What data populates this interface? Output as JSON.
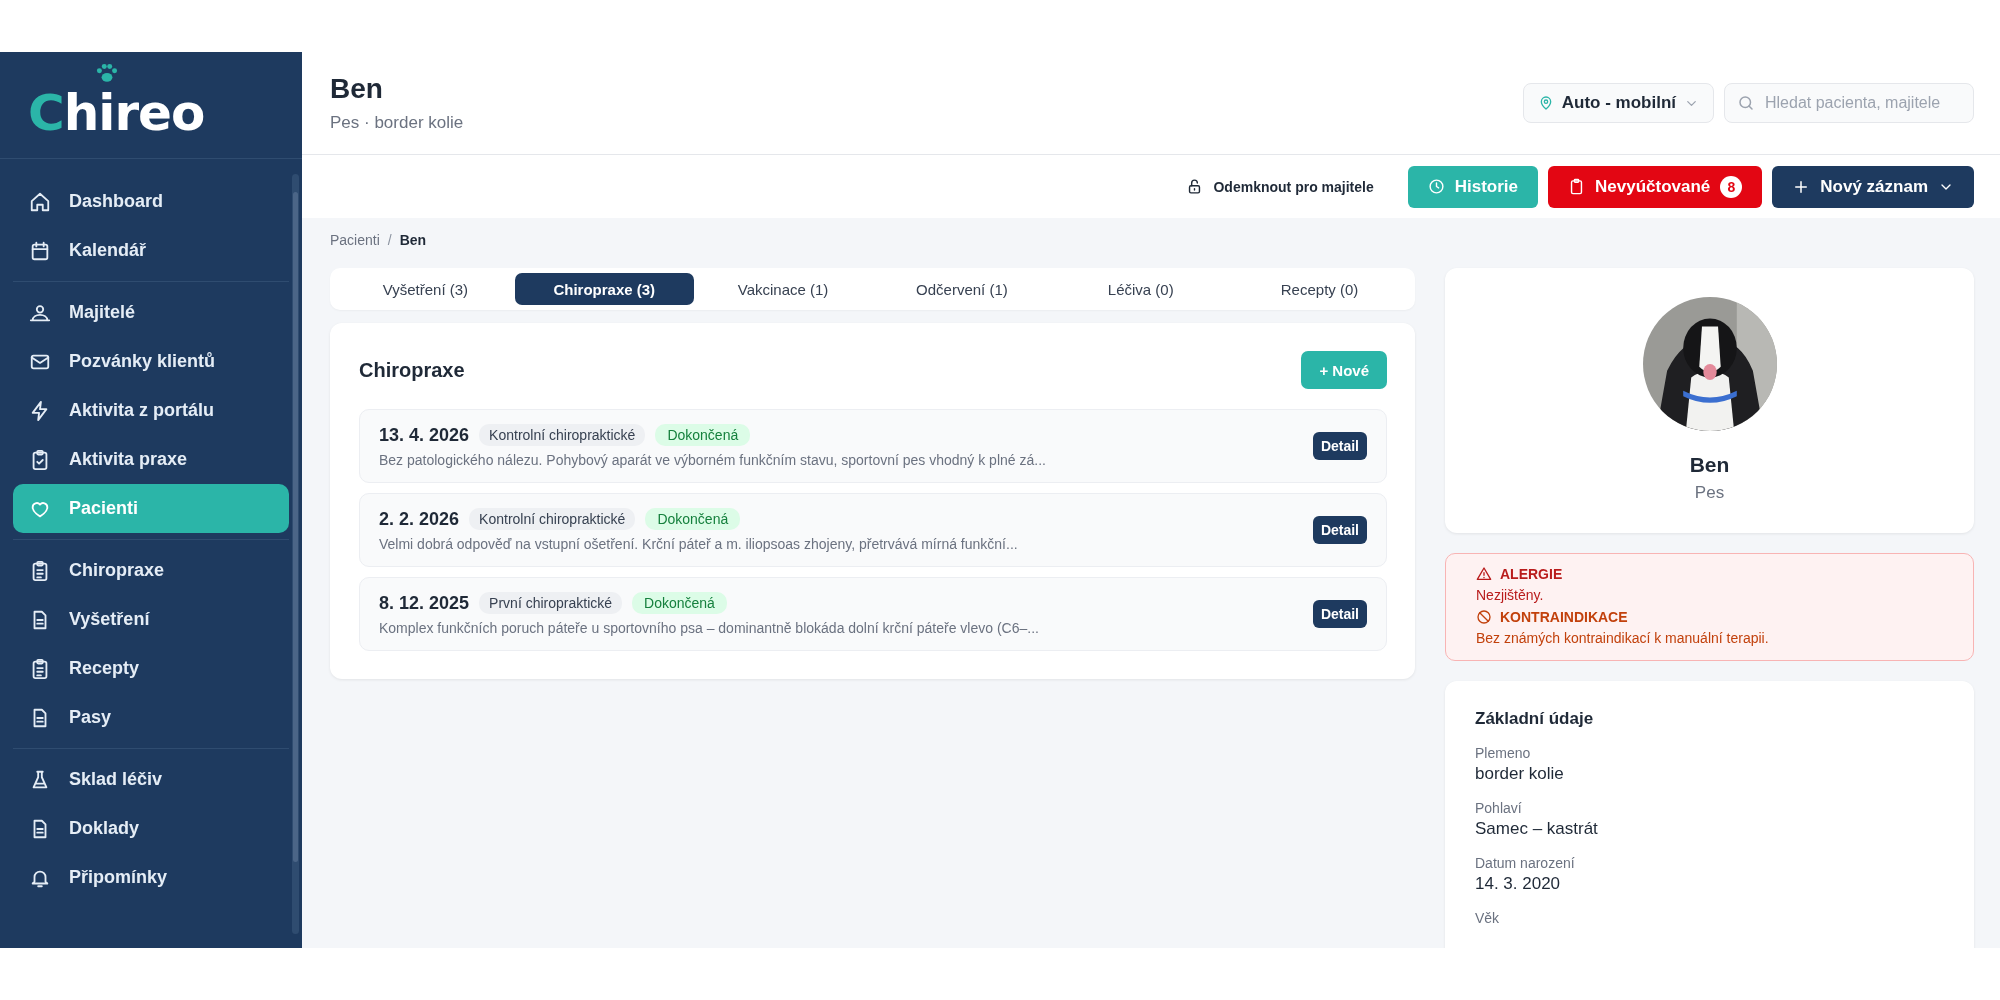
{
  "sidebar": {
    "logo": "Chireo",
    "groups": [
      {
        "items": [
          {
            "label": "Dashboard",
            "selected": false
          },
          {
            "label": "Kalendář",
            "selected": false
          }
        ]
      },
      {
        "items": [
          {
            "label": "Majitelé",
            "selected": false
          },
          {
            "label": "Pozvánky klientů",
            "selected": false
          },
          {
            "label": "Aktivita z portálu",
            "selected": false
          },
          {
            "label": "Aktivita praxe",
            "selected": false
          },
          {
            "label": "Pacienti",
            "selected": true
          }
        ]
      },
      {
        "items": [
          {
            "label": "Chiropraxe",
            "selected": false
          },
          {
            "label": "Vyšetření",
            "selected": false
          },
          {
            "label": "Recepty",
            "selected": false
          },
          {
            "label": "Pasy",
            "selected": false
          }
        ]
      },
      {
        "items": [
          {
            "label": "Sklad léčiv",
            "selected": false
          },
          {
            "label": "Doklady",
            "selected": false
          },
          {
            "label": "Připomínky",
            "selected": false
          }
        ]
      }
    ]
  },
  "header": {
    "title": "Ben",
    "subtitle": "Pes · border kolie",
    "location": "Auto - mobilní",
    "search": {
      "placeholder": "Hledat pacienta, majitele"
    }
  },
  "toolbar": {
    "unlock": "Odemknout pro majitele",
    "history": "Historie",
    "unbilled": "Nevyúčtované",
    "unbilled_count": "8",
    "new_record": "Nový záznam"
  },
  "breadcrumb": {
    "separator": "/",
    "items": [
      "Pacienti",
      "Ben"
    ]
  },
  "tabs": [
    {
      "label": "Vyšetření (3)",
      "selected": false
    },
    {
      "label": "Chiropraxe (3)",
      "selected": true
    },
    {
      "label": "Vakcinace (1)",
      "selected": false
    },
    {
      "label": "Odčervení (1)",
      "selected": false
    },
    {
      "label": "Léčiva (0)",
      "selected": false
    },
    {
      "label": "Recepty (0)",
      "selected": false
    }
  ],
  "records": {
    "title": "Chiropraxe",
    "add_button": "+ Nové",
    "items": [
      {
        "date": "13. 4. 2026",
        "type": "Kontrolní chiropraktické",
        "status": "Dokončená",
        "summary": "Bez patologického nálezu. Pohybový aparát ve výborném funkčním stavu, sportovní pes vhodný k plné zá...",
        "button": "Detail"
      },
      {
        "date": "2. 2. 2026",
        "type": "Kontrolní chiropraktické",
        "status": "Dokončená",
        "summary": "Velmi dobrá odpověď na vstupní ošetření. Krční páteř a m. iliopsoas zhojeny, přetrvává mírná funkční...",
        "button": "Detail"
      },
      {
        "date": "8. 12. 2025",
        "type": "První chiropraktické",
        "status": "Dokončená",
        "summary": "Komplex funkčních poruch páteře u sportovního psa – dominantně blokáda dolní krční páteře vlevo (C6–...",
        "button": "Detail"
      }
    ]
  },
  "profile": {
    "name": "Ben",
    "species": "Pes"
  },
  "alerts": [
    {
      "kind": "allergy",
      "title": "ALERGIE",
      "text": "Nezjištěny."
    },
    {
      "kind": "contraindication",
      "title": "KONTRAINDIKACE",
      "text": "Bez známých kontraindikací k manuální terapii."
    }
  ],
  "basic_info": {
    "title": "Základní údaje",
    "fields": [
      {
        "label": "Plemeno",
        "value": "border kolie"
      },
      {
        "label": "Pohlaví",
        "value": "Samec – kastrát"
      },
      {
        "label": "Datum narození",
        "value": "14. 3. 2020"
      },
      {
        "label": "Věk"
      }
    ]
  }
}
